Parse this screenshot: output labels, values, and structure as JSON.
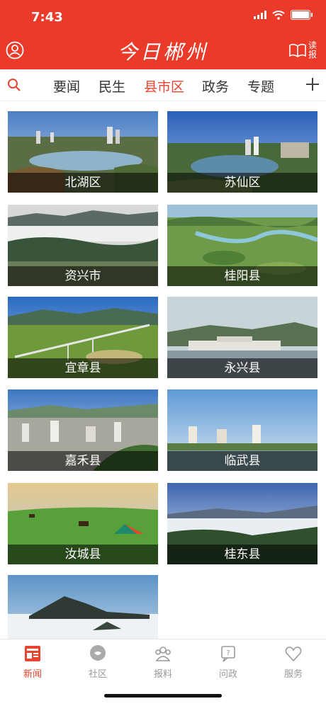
{
  "status_bar": {
    "time": "7:43"
  },
  "header": {
    "title": "今日郴州",
    "read_label_1": "读",
    "read_label_2": "报"
  },
  "tabs": [
    {
      "label": "要闻"
    },
    {
      "label": "民生"
    },
    {
      "label": "县市区",
      "active": true
    },
    {
      "label": "政务"
    },
    {
      "label": "专题"
    }
  ],
  "regions": [
    {
      "label": "北湖区"
    },
    {
      "label": "苏仙区"
    },
    {
      "label": "资兴市"
    },
    {
      "label": "桂阳县"
    },
    {
      "label": "宜章县"
    },
    {
      "label": "永兴县"
    },
    {
      "label": "嘉禾县"
    },
    {
      "label": "临武县"
    },
    {
      "label": "汝城县"
    },
    {
      "label": "桂东县"
    },
    {
      "label": ""
    }
  ],
  "bottom_nav": [
    {
      "label": "新闻",
      "icon": "news-icon",
      "active": true
    },
    {
      "label": "社区",
      "icon": "community-icon"
    },
    {
      "label": "报料",
      "icon": "report-tip-icon"
    },
    {
      "label": "问政",
      "icon": "ask-gov-icon"
    },
    {
      "label": "服务",
      "icon": "service-icon"
    }
  ],
  "colors": {
    "brand_red": "#ea3b2a",
    "active_tab": "#e8442f",
    "inactive_nav": "#999999"
  }
}
